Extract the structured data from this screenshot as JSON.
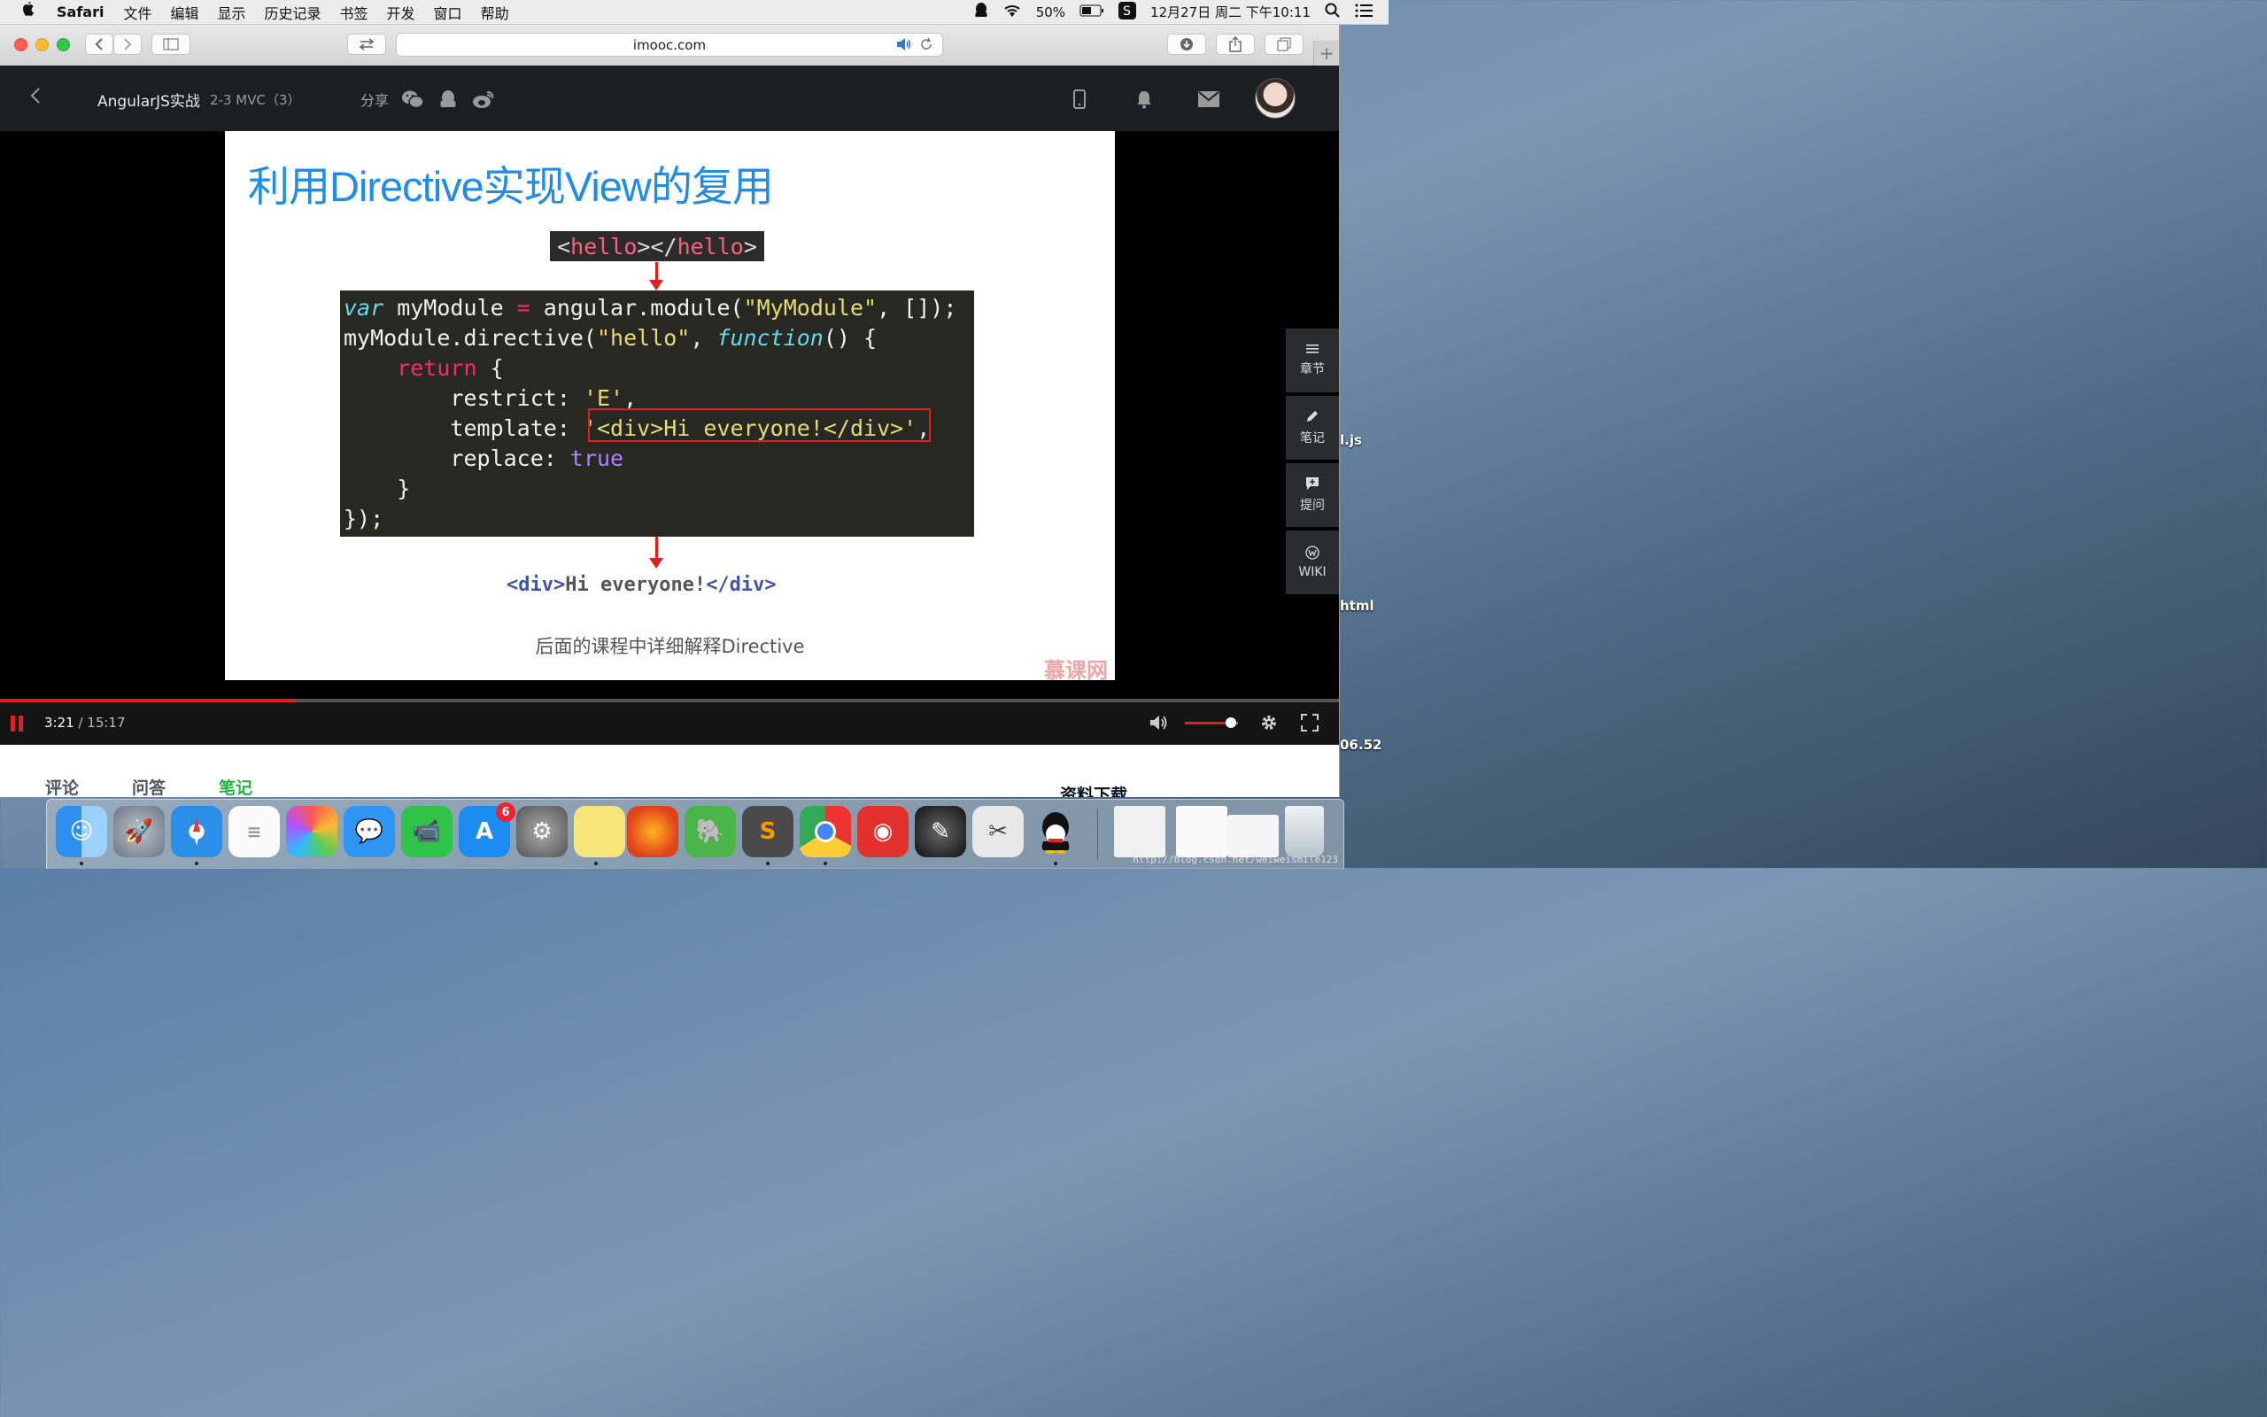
{
  "menubar": {
    "app_name": "Safari",
    "items": [
      "文件",
      "编辑",
      "显示",
      "历史记录",
      "书签",
      "开发",
      "窗口",
      "帮助"
    ],
    "battery": "50%",
    "datetime": "12月27日 周二 下午10:11"
  },
  "browser": {
    "url": "imooc.com"
  },
  "site_header": {
    "course_title": "AngularJS实战",
    "lesson": "2-3 MVC（3）",
    "share_label": "分享"
  },
  "slide": {
    "title": "利用Directive实现View的复用",
    "tag_open": "<",
    "tag_kw1": "hello",
    "tag_mid": "></",
    "tag_kw2": "hello",
    "tag_close": ">",
    "code": {
      "l1_var": "var",
      "l1_a": " myModule ",
      "l1_eq": "=",
      "l1_b": " angular.module(",
      "l1_str": "\"MyModule\"",
      "l1_c": ", []);",
      "l2_a": "myModule.directive(",
      "l2_str": "\"hello\"",
      "l2_b": ", ",
      "l2_fn": "function",
      "l2_c": "() {",
      "l3_ret": "return",
      "l3_a": " {",
      "l4_a": "restrict: ",
      "l4_str": "'E'",
      "l4_b": ",",
      "l5_a": "template: ",
      "l5_str": "'<div>Hi everyone!</div>'",
      "l5_b": ",",
      "l6_a": "replace: ",
      "l6_true": "true",
      "l7": "}",
      "l8": "});"
    },
    "result_open": "<div>",
    "result_text": "Hi everyone!",
    "result_close": "</div>",
    "note": "后面的课程中详细解释Directive",
    "watermark": "慕课网"
  },
  "player": {
    "current_time": "3:21",
    "separator": " / ",
    "total_time": "15:17",
    "progress": 0.22,
    "volume": 0.87
  },
  "side_panel": {
    "chapters": "章节",
    "notes": "笔记",
    "ask": "提问",
    "wiki": "WIKI"
  },
  "tabs": [
    "评论",
    "问答",
    "笔记"
  ],
  "active_tab": "笔记",
  "downloads_label": "资料下载",
  "desktop": {
    "label1": "l.js",
    "label2": "html",
    "label3": "06.52"
  },
  "dock": {
    "appstore_badge": "6",
    "csdn_watermark": "http://blog.csdn.net/weiweismile123"
  },
  "colors": {
    "accent_blue": "#1f8ce8",
    "active_tab_green": "#1fb53f",
    "progress_red": "#e01b1b"
  }
}
